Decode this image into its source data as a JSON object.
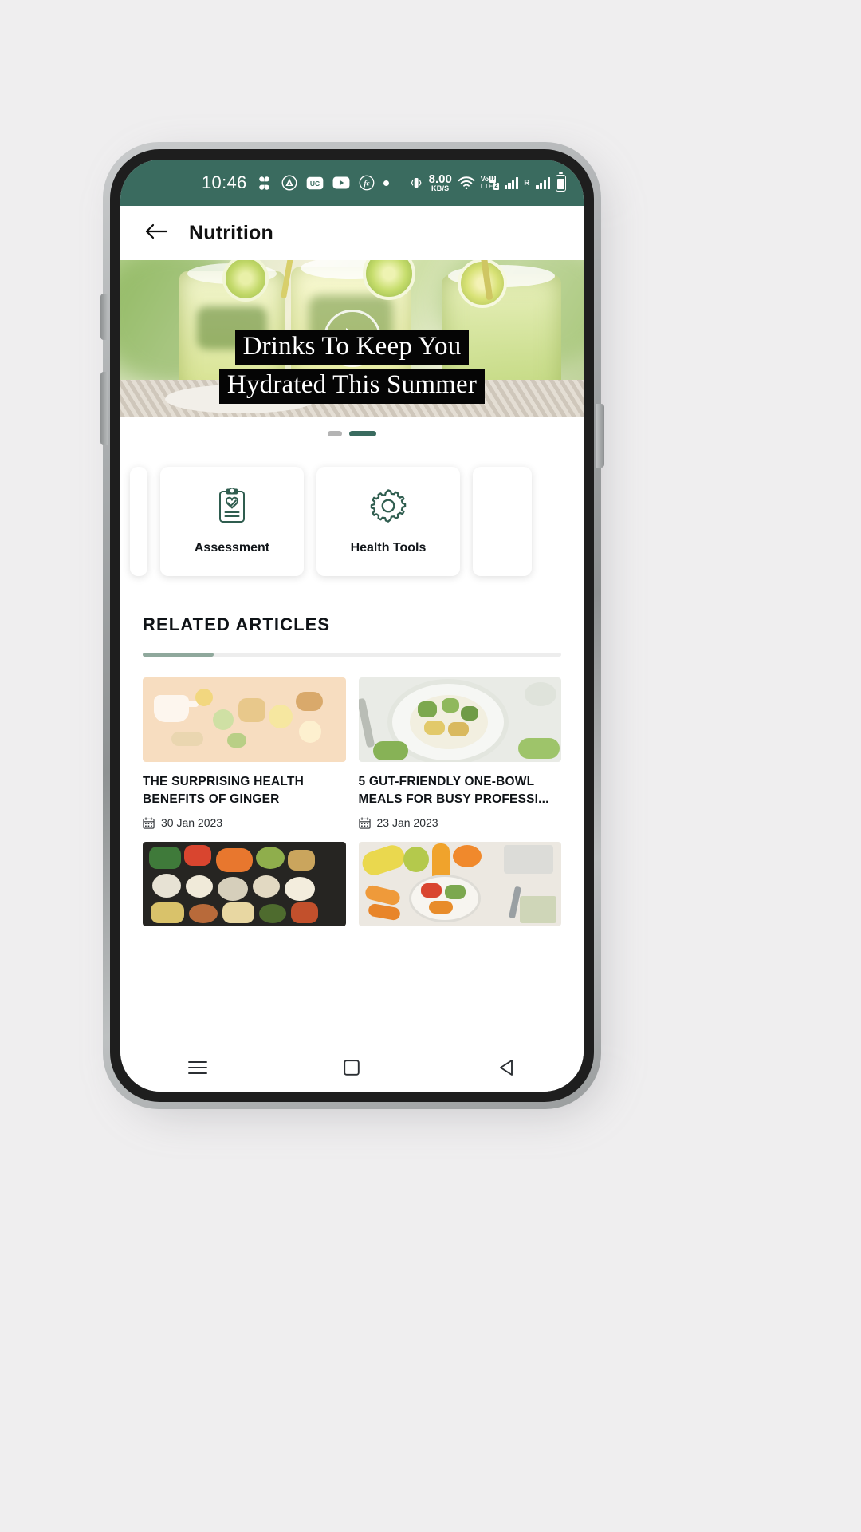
{
  "status_bar": {
    "time": "10:46",
    "left_icons": [
      "clover-icon",
      "autodesk-triangle-icon",
      "uc-browser-icon",
      "youtube-icon",
      "fc-circle-icon",
      "dot-icon"
    ],
    "uc_label": "UC",
    "fc_label": "fc",
    "net_speed_value": "8.00",
    "net_speed_unit": "KB/S",
    "volte_line1": "Vo",
    "volte_badge1": "D",
    "volte_line2": "LTE",
    "volte_badge2": "2",
    "roaming_label": "R",
    "right_icons": [
      "vibrate-icon",
      "network-speed-icon",
      "wifi-icon",
      "volte-icon",
      "signal-bars-icon",
      "roaming-signal-icon",
      "battery-icon"
    ],
    "bg_color": "#3a6b5f"
  },
  "app_bar": {
    "back_icon": "arrow-left-icon",
    "title": "Nutrition"
  },
  "hero": {
    "caption_line1": "Drinks To Keep You",
    "caption_line2": "Hydrated This Summer",
    "play_icon": "play-icon",
    "alt": "two glasses of mint lemonade with lime slices"
  },
  "carousel": {
    "dots": [
      {
        "label": "slide-1",
        "active": false
      },
      {
        "label": "slide-2",
        "active": true
      }
    ]
  },
  "quick_actions": {
    "cards": [
      {
        "label": "Assessment",
        "icon": "clipboard-heart-check-icon"
      },
      {
        "label": "Health Tools",
        "icon": "gear-icon"
      }
    ],
    "icon_color": "#2f5d4f"
  },
  "related": {
    "heading": "RELATED ARTICLES",
    "progress_percent": 17,
    "progress_color": "#8fa89c",
    "articles": [
      {
        "title": "THE SURPRISING HEALTH BENEFITS OF GINGER",
        "date": "30 Jan 2023",
        "date_icon": "calendar-icon",
        "thumb": "ginger-lemon-honey-flatlay"
      },
      {
        "title": "5 GUT-FRIENDLY ONE-BOWL MEALS FOR BUSY PROFESSI...",
        "date": "23 Jan 2023",
        "date_icon": "calendar-icon",
        "thumb": "broccoli-rice-bowl"
      },
      {
        "title": "",
        "date": "",
        "date_icon": "calendar-icon",
        "thumb": "assorted-healthy-foods-dark-background"
      },
      {
        "title": "",
        "date": "",
        "date_icon": "calendar-icon",
        "thumb": "fruits-vegetables-desk-flatlay"
      }
    ]
  },
  "nav_bar": {
    "items": [
      {
        "icon": "recents-menu-icon"
      },
      {
        "icon": "home-square-icon"
      },
      {
        "icon": "back-triangle-icon"
      }
    ]
  }
}
